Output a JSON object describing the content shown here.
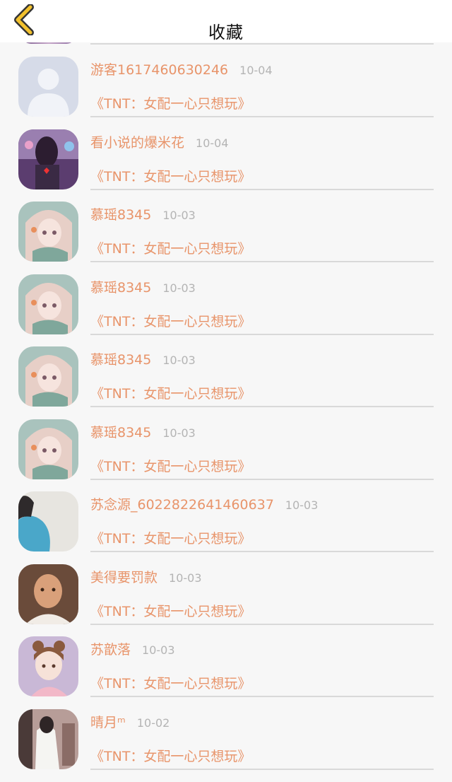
{
  "header": {
    "title": "收藏",
    "back_icon": "chevron-left-icon",
    "accent": "#f2c12e"
  },
  "colors": {
    "name": "#e8946a",
    "date": "#b4b4b4",
    "divider": "#d9d9d9"
  },
  "items": [
    {
      "user": "游客1617460630246",
      "date": "10-04",
      "book": "《TNT：女配一心只想玩》",
      "avatar": "default-person-avatar"
    },
    {
      "user": "看小说的爆米花",
      "date": "10-04",
      "book": "《TNT：女配一心只想玩》",
      "avatar": "purple-photo-avatar"
    },
    {
      "user": "慕瑶8345",
      "date": "10-03",
      "book": "《TNT：女配一心只想玩》",
      "avatar": "anime-girl-avatar"
    },
    {
      "user": "慕瑶8345",
      "date": "10-03",
      "book": "《TNT：女配一心只想玩》",
      "avatar": "anime-girl-avatar"
    },
    {
      "user": "慕瑶8345",
      "date": "10-03",
      "book": "《TNT：女配一心只想玩》",
      "avatar": "anime-girl-avatar"
    },
    {
      "user": "慕瑶8345",
      "date": "10-03",
      "book": "《TNT：女配一心只想玩》",
      "avatar": "anime-girl-avatar"
    },
    {
      "user": "苏念源_6022822641460637",
      "date": "10-03",
      "book": "《TNT：女配一心只想玩》",
      "avatar": "blue-shirt-avatar"
    },
    {
      "user": "美得要罚款",
      "date": "10-03",
      "book": "《TNT：女配一心只想玩》",
      "avatar": "man-photo-avatar"
    },
    {
      "user": "苏歆落",
      "date": "10-03",
      "book": "《TNT：女配一心只想玩》",
      "avatar": "illustrated-girl-avatar"
    },
    {
      "user": "晴月ᵐ",
      "date": "10-02",
      "book": "《TNT：女配一心只想玩》",
      "avatar": "mirror-selfie-avatar"
    }
  ]
}
